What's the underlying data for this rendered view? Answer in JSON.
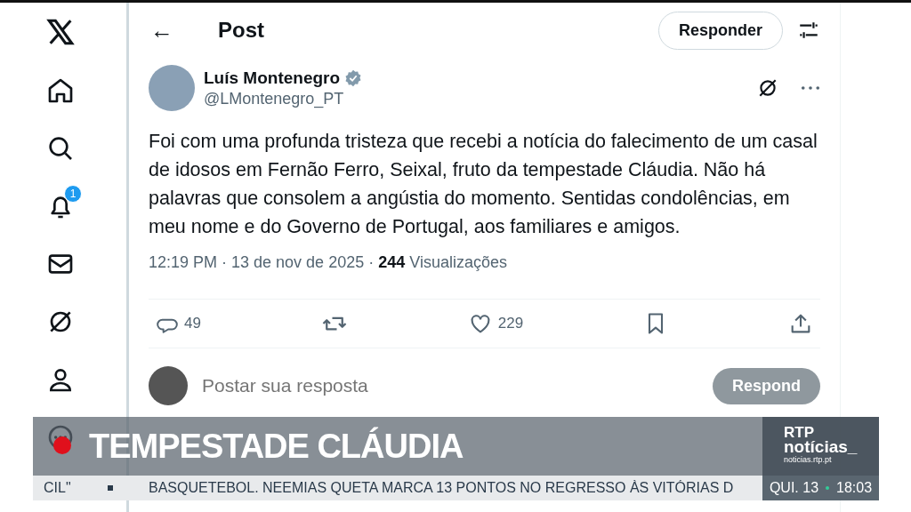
{
  "sidebar": {
    "items": [
      {
        "kind": "logo"
      },
      {
        "kind": "home"
      },
      {
        "kind": "search"
      },
      {
        "kind": "bell",
        "badge": "1"
      },
      {
        "kind": "mail"
      },
      {
        "kind": "grok"
      },
      {
        "kind": "person"
      },
      {
        "kind": "more"
      }
    ]
  },
  "header": {
    "back": "←",
    "title": "Post",
    "reply_button": "Responder"
  },
  "post": {
    "author": "Luís Montenegro",
    "verified": true,
    "handle": "@LMontenegro_PT",
    "text": "Foi com uma profunda tristeza que recebi a notícia do falecimento de um casal de idosos em Fernão Ferro, Seixal, fruto da tempestade Cláudia. Não há palavras que consolem a angústia do momento. Sentidas condolências, em meu nome e do Governo de Portugal, aos familiares e amigos.",
    "time": "12:19 PM · 13 de nov de 2025 · ",
    "views_count": "244",
    "views_label": "Visualizações",
    "actions": [
      {
        "kind": "reply",
        "count": "49"
      },
      {
        "kind": "repost"
      },
      {
        "kind": "like",
        "count": "229"
      },
      {
        "kind": "bookmark"
      },
      {
        "kind": "share"
      }
    ]
  },
  "reply_box": {
    "placeholder": "Postar sua resposta",
    "button": "Respond"
  },
  "broadcast": {
    "headline": "TEMPESTADE CLÁUDIA",
    "logo_top": "RTP",
    "logo_bottom": "notícias_",
    "logo_url": "noticias.rtp.pt",
    "ticker": {
      "prev": "CIL\"",
      "item": "BASQUETEBOL. NEEMIAS QUETA MARCA 13 PONTOS NO REGRESSO ÀS VITÓRIAS D",
      "day": "QUI. 13",
      "time": "18:03"
    }
  }
}
